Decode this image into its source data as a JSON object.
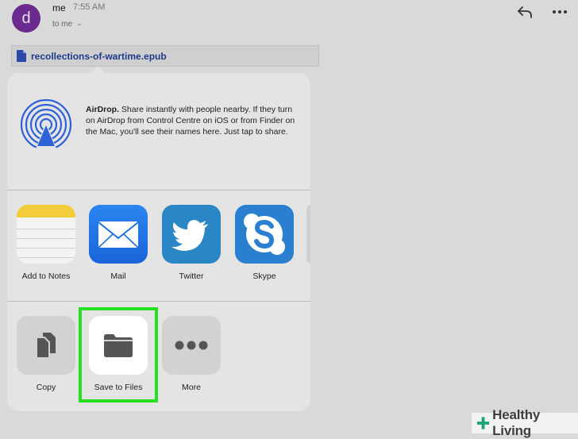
{
  "email": {
    "avatar_letter": "d",
    "sender": "me",
    "time": "7:55 AM",
    "recipient": "to me",
    "attachment_name": "recollections-of-wartime.epub",
    "icons": [
      "reply-icon",
      "more-icon",
      "document-icon",
      "chevron-down-icon"
    ]
  },
  "share_sheet": {
    "airdrop": {
      "title": "AirDrop.",
      "description": "Share instantly with people nearby. If they turn on AirDrop from Control Centre on iOS or from Finder on the Mac, you'll see their names here. Just tap to share."
    },
    "apps": [
      {
        "label": "Add to Notes",
        "icon": "notes-icon"
      },
      {
        "label": "Mail",
        "icon": "mail-icon"
      },
      {
        "label": "Twitter",
        "icon": "twitter-icon"
      },
      {
        "label": "Skype",
        "icon": "skype-icon"
      }
    ],
    "actions": [
      {
        "label": "Copy",
        "icon": "copy-icon"
      },
      {
        "label": "Save to Files",
        "icon": "folder-icon",
        "highlighted": true
      },
      {
        "label": "More",
        "icon": "more-dots-icon"
      }
    ]
  },
  "colors": {
    "highlight": "#25e01f",
    "avatar": "#6a2a8e",
    "link": "#1f3a8a",
    "watermark_accent": "#1aa37a"
  },
  "watermark": {
    "text": "Healthy Living"
  }
}
